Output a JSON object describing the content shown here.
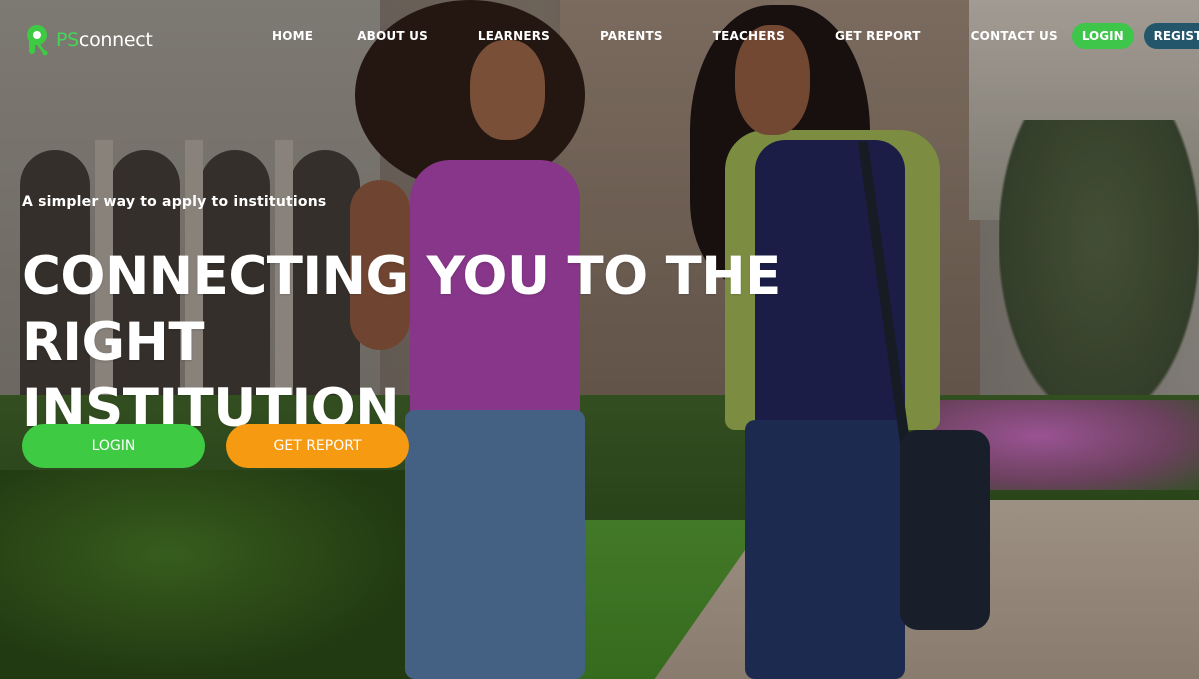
{
  "brand": {
    "logo_prefix": "PS",
    "logo_suffix": "connect",
    "accent": "#44d457"
  },
  "nav": {
    "items": [
      "HOME",
      "ABOUT US",
      "LEARNERS",
      "PARENTS",
      "TEACHERS",
      "GET REPORT",
      "CONTACT US"
    ],
    "login_label": "LOGIN",
    "register_label": "REGISTER",
    "login_color": "#3dc64a",
    "register_color": "#23556b"
  },
  "hero": {
    "tagline": "A simpler way to apply to institutions",
    "headline_line1": "CONNECTING YOU TO THE RIGHT",
    "headline_line2": "INSTITUTION",
    "login_button": "LOGIN",
    "report_button": "GET REPORT",
    "login_color": "#3ecb43",
    "report_color": "#f59a11"
  }
}
